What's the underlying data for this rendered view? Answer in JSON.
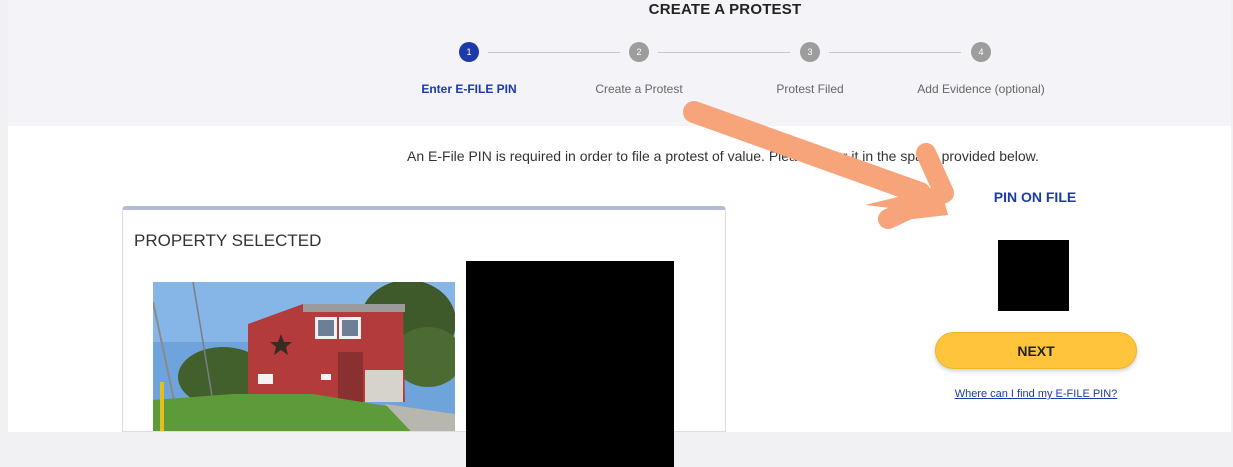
{
  "header": {
    "title": "CREATE A PROTEST"
  },
  "stepper": {
    "steps": [
      {
        "number": "1",
        "label": "Enter E-FILE PIN",
        "active": true
      },
      {
        "number": "2",
        "label": "Create a Protest",
        "active": false
      },
      {
        "number": "3",
        "label": "Protest Filed",
        "active": false
      },
      {
        "number": "4",
        "label": "Add Evidence (optional)",
        "active": false
      }
    ]
  },
  "main": {
    "instruction": "An E-File PIN is required in order to file a protest of value. Please enter it in the space provided below."
  },
  "property_card": {
    "title": "PROPERTY SELECTED",
    "photo_icon": "house-photo"
  },
  "pin_panel": {
    "title": "PIN ON FILE",
    "next_label": "NEXT",
    "help_link": "Where can I find my E-FILE PIN?"
  },
  "colors": {
    "primary_blue": "#1c3aa9",
    "button_yellow": "#fec43b",
    "annotation_arrow": "#f7a47a",
    "inactive_step": "#9d9d9d"
  }
}
